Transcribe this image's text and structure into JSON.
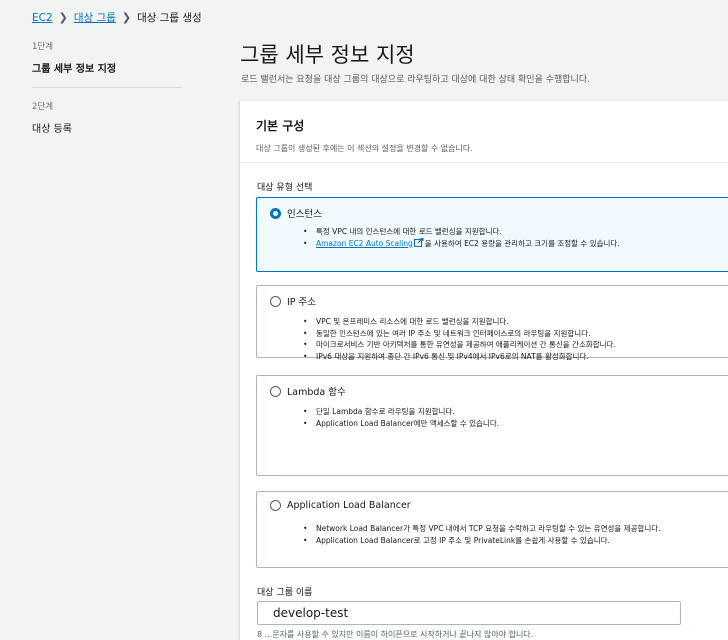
{
  "breadcrumb": {
    "items": [
      {
        "label": "EC2",
        "link": true
      },
      {
        "label": "대상 그룹",
        "link": true
      },
      {
        "label": "대상 그룹 생성",
        "link": false
      }
    ],
    "separator": "❯"
  },
  "steps": [
    {
      "step": "1단계",
      "title": "그룹 세부 정보 지정",
      "active": true
    },
    {
      "step": "2단계",
      "title": "대상 등록",
      "active": false
    }
  ],
  "page": {
    "title": "그룹 세부 정보 지정",
    "subtitle": "로드 밸런서는 요청을 대상 그룹의 대상으로 라우팅하고 대상에 대한 상태 확인을 수행합니다."
  },
  "basic_config": {
    "title": "기본 구성",
    "description": "대상 그룹이 생성된 후에는 이 섹션의 설정을 변경할 수 없습니다.",
    "target_type_label": "대상 유형 선택",
    "options": [
      {
        "title": "인스턴스",
        "selected": true,
        "bullets": [
          "특정 VPC 내의 인스턴스에 대한 로드 밸런싱을 지원합니다."
        ],
        "link_bullet": {
          "link_text": "Amazon EC2 Auto Scaling",
          "rest": "을 사용하여 EC2 용량을 관리하고 크기를 조정할 수 있습니다."
        }
      },
      {
        "title": "IP 주소",
        "selected": false,
        "bullets": [
          "VPC 및 온프레미스 리소스에 대한 로드 밸런싱을 지원합니다.",
          "동일한 인스턴스에 있는 여러 IP 주소 및 네트워크 인터페이스로의 라우팅을 지원합니다.",
          "마이크로서비스 기반 아키텍처를 통한 유연성을 제공하여 애플리케이션 간 통신을 간소화합니다.",
          "IPv6 대상을 지원하여 종단 간 IPv6 통신 및 IPv4에서 IPv6로의 NAT를 활성화합니다."
        ]
      },
      {
        "title": "Lambda 함수",
        "selected": false,
        "bullets": [
          "단일 Lambda 함수로 라우팅을 지원합니다.",
          "Application Load Balancer에만 액세스할 수 있습니다."
        ]
      },
      {
        "title": "Application Load Balancer",
        "selected": false,
        "bullets": [
          "Network Load Balancer가 특정 VPC 내에서 TCP 요청을 수락하고 라우팅할 수 있는 유연성을 제공합니다.",
          "Application Load Balancer로 고정 IP 주소 및 PrivateLink를 손쉽게 사용할 수 있습니다."
        ]
      }
    ],
    "name_label": "대상 그룹 이름",
    "name_value": "develop-test",
    "name_hint": "8 ...문자를 사용할 수 있지만 이름이 하이픈으로 시작하거나 끝나지 않아야 합니다."
  },
  "colors": {
    "accent": "#0073bb",
    "background": "#f2f3f3",
    "selected_card": "#f1faff"
  }
}
